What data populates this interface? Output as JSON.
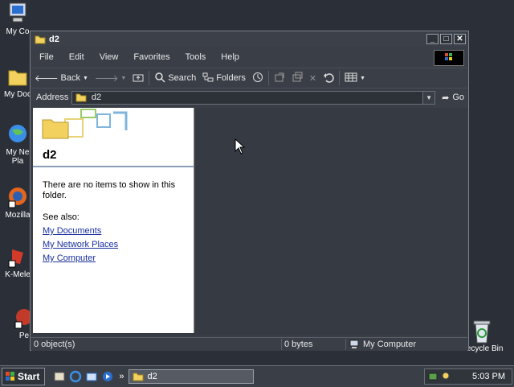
{
  "desktop": {
    "icons": [
      {
        "label": "My Co",
        "icon": "my-computer-icon"
      },
      {
        "label": "My Doc",
        "icon": "my-documents-icon"
      },
      {
        "label": "My Ne",
        "label2": "Pla",
        "icon": "network-places-icon"
      },
      {
        "label": "Mozilla",
        "icon": "firefox-icon"
      },
      {
        "label": "K-Mele",
        "icon": "kmeleon-icon"
      },
      {
        "label": "Pe",
        "icon": "shortcut-icon"
      }
    ],
    "recycle_bin": "Recycle Bin"
  },
  "window": {
    "title": "d2",
    "menu": [
      "File",
      "Edit",
      "View",
      "Favorites",
      "Tools",
      "Help"
    ],
    "toolbar": {
      "back": "Back",
      "search": "Search",
      "folders": "Folders"
    },
    "address": {
      "label": "Address",
      "value": "d2",
      "go": "Go"
    },
    "taskpane": {
      "title": "d2",
      "empty_message": "There are no items to show in this folder.",
      "see_also": "See also:",
      "links": [
        "My Documents",
        "My Network Places",
        "My Computer"
      ]
    },
    "status": {
      "objects": "0 object(s)",
      "size": "0 bytes",
      "zone": "My Computer"
    }
  },
  "taskbar": {
    "start": "Start",
    "task": "d2",
    "quicklaunch_more": "»",
    "clock": "5:03 PM"
  },
  "colors": {
    "accent": "#1a2f9e",
    "desktop": "#2b3038",
    "window": "#3a3f47"
  }
}
